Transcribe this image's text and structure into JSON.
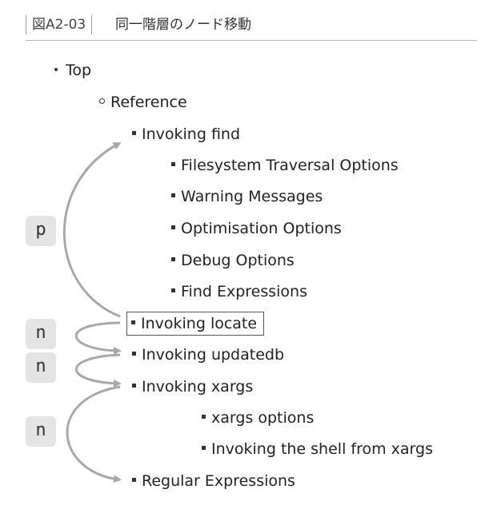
{
  "figure": {
    "number": "図A2-03",
    "title": "同一階層のノード移動"
  },
  "tree": {
    "top": "Top",
    "reference": "Reference",
    "invoking_find": "Invoking find",
    "filesystem_traversal": "Filesystem Traversal Options",
    "warning_messages": "Warning Messages",
    "optimisation_options": "Optimisation Options",
    "debug_options": "Debug Options",
    "find_expressions": "Find Expressions",
    "invoking_locate": "Invoking locate",
    "invoking_updatedb": "Invoking updatedb",
    "invoking_xargs": "Invoking xargs",
    "xargs_options": "xargs options",
    "invoking_shell": "Invoking the shell from xargs",
    "regular_expressions": "Regular Expressions"
  },
  "keys": {
    "prev": "p",
    "next1": "n",
    "next2": "n",
    "next3": "n"
  },
  "colors": {
    "arrow": "#a8a8a8",
    "key_bg": "#e4e4e4",
    "rule": "#b4b4b4"
  }
}
